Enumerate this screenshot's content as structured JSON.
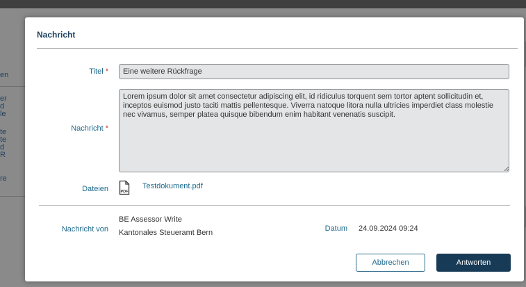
{
  "background": {
    "fragments": [
      "en",
      "er",
      "d",
      "le",
      "te",
      "te",
      "d",
      "R",
      "re"
    ]
  },
  "dialog": {
    "title": "Nachricht",
    "required_marker": "*",
    "fields": {
      "title_label": "Titel",
      "title_value": "Eine weitere Rückfrage",
      "message_label": "Nachricht",
      "message_value": "Lorem ipsum dolor sit amet consectetur adipiscing elit, id ridiculus torquent sem tortor aptent sollicitudin et, inceptos euismod justo taciti mattis pellentesque. Viverra natoque litora nulla ultricies imperdiet class molestie nec vivamus, semper platea quisque bibendum enim habitant venenatis suscipit.",
      "files_label": "Dateien",
      "file_icon_text": "PDF",
      "file_name": "Testdokument.pdf"
    },
    "meta": {
      "from_label": "Nachricht von",
      "from_name": "BE Assessor Write",
      "from_org": "Kantonales Steueramt  Bern",
      "date_label": "Datum",
      "date_value": "24.09.2024 09:24"
    },
    "buttons": {
      "cancel": "Abbrechen",
      "reply": "Antworten"
    },
    "colors": {
      "label": "#1e6a8d",
      "required": "#c0392b",
      "primary_button": "#173b56"
    },
    "icons": [
      "pdf-file-icon"
    ]
  }
}
